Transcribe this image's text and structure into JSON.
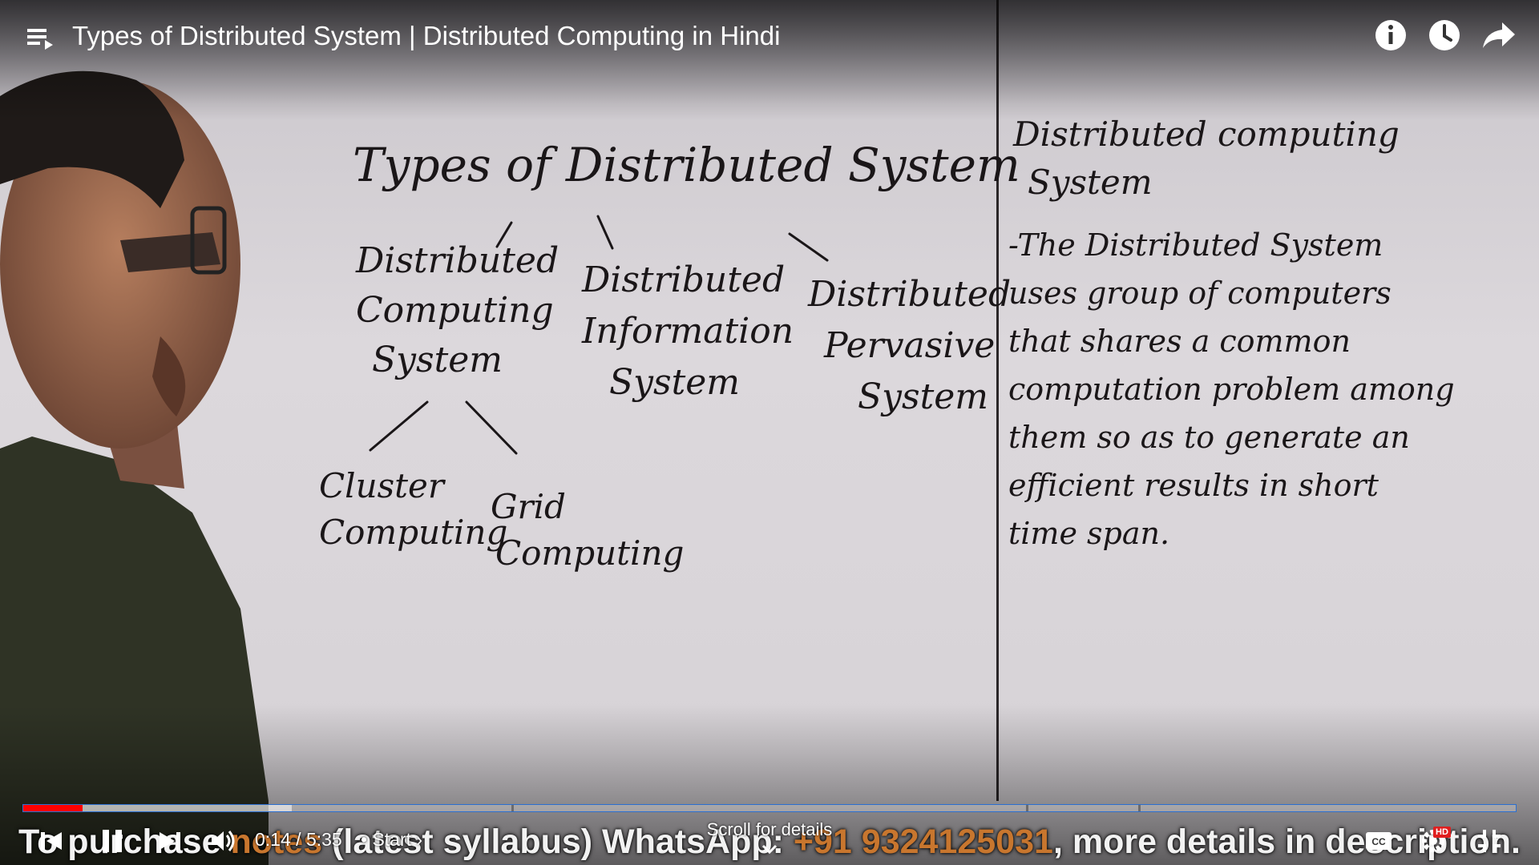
{
  "header": {
    "title": "Types of Distributed System | Distributed Computing in Hindi",
    "icons": [
      "playlist-icon",
      "info-icon",
      "watch-later-icon",
      "share-icon"
    ]
  },
  "whiteboard": {
    "heading": "Types of Distributed System",
    "branch_computing": [
      "Distributed",
      "Computing",
      "System"
    ],
    "branch_information": [
      "Distributed",
      "Information",
      "System"
    ],
    "branch_pervasive": [
      "Distributed",
      "Pervasive",
      "System"
    ],
    "sub_cluster": [
      "Cluster",
      "Computing"
    ],
    "sub_grid": [
      "Grid",
      "Computing"
    ],
    "right_heading": [
      "Distributed computing",
      "System"
    ],
    "definition": [
      "-The Distributed System",
      "uses group of computers",
      "that shares a common",
      "computation problem among",
      "them so as to generate an",
      "efficient results in short",
      "time span."
    ]
  },
  "player": {
    "current_time": "0:14",
    "separator": " / ",
    "duration": "5:35",
    "chapter_label": "• Start ›",
    "scroll_hint": "Scroll for details",
    "hd_badge": "HD",
    "progress_played_fraction": 0.04,
    "progress_buffered_fraction": 0.18,
    "accent_color": "#ff0000"
  },
  "caption": {
    "part1": "To purchase ",
    "part2": "notes",
    "part3": " (latest syllabus) WhatsApp: ",
    "part4": "+91 9324125031",
    "part5": ", more details in description."
  }
}
